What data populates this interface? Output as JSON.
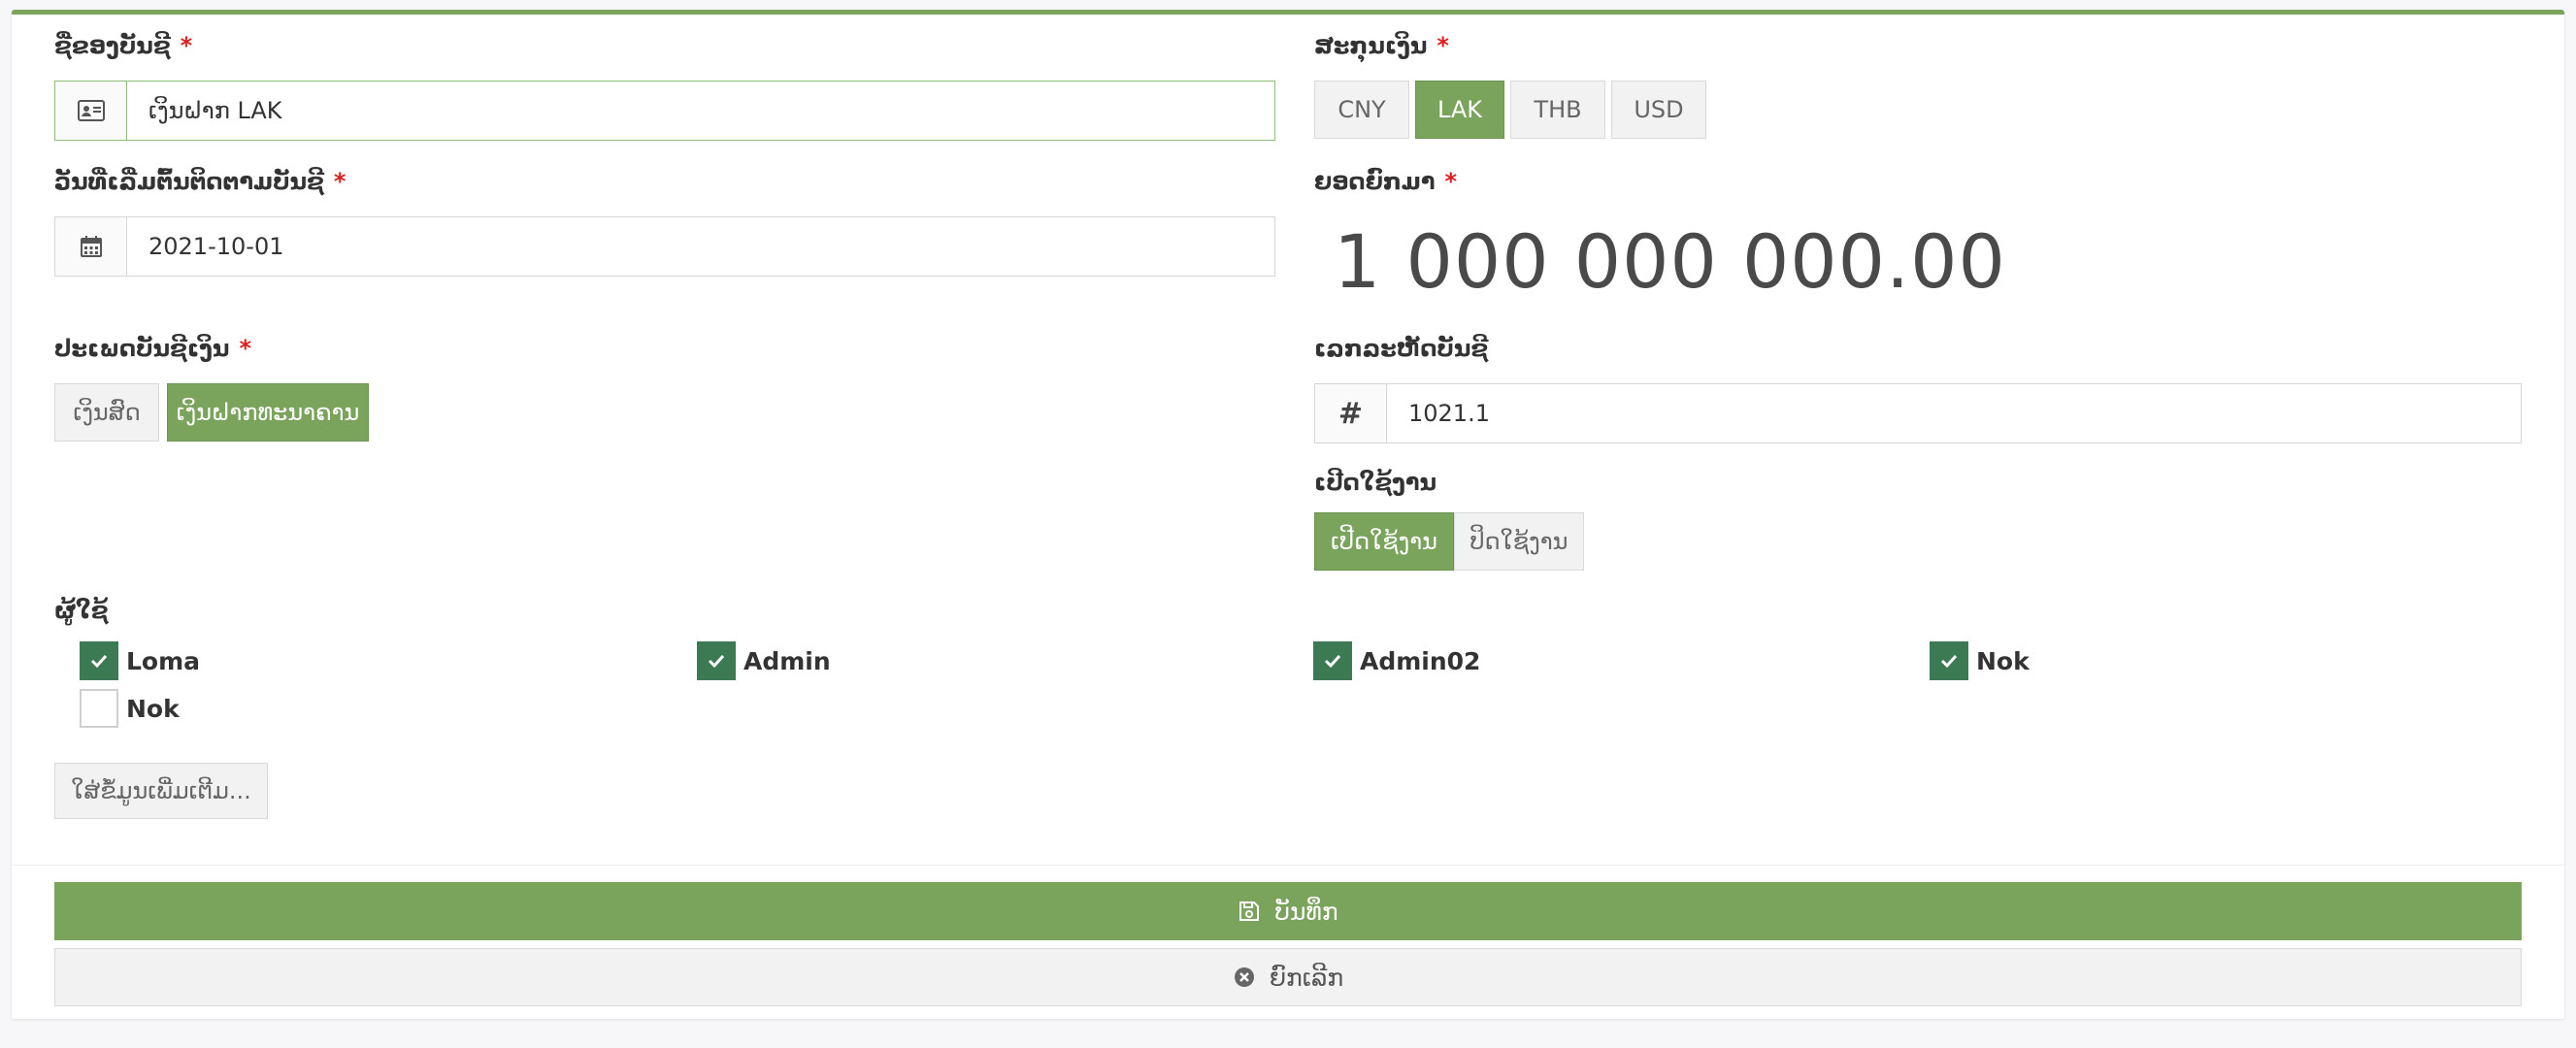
{
  "form": {
    "account_name": {
      "label": "ຊື່ຂອງບັນຊີ",
      "required_mark": "*",
      "value": "ເງິນຝາກ LAK",
      "icon": "id-card-icon"
    },
    "currency": {
      "label": "ສະກຸນເງິນ",
      "required_mark": "*",
      "options": [
        "CNY",
        "LAK",
        "THB",
        "USD"
      ],
      "selected": "LAK"
    },
    "start_date": {
      "label": "ວັນທີ່ເລີ່ມຕົ້ນຕິດຕາມບັນຊີ",
      "required_mark": "*",
      "value": "2021-10-01",
      "icon": "calendar-icon"
    },
    "balance": {
      "label": "ຍອດຍົກມາ",
      "required_mark": "*",
      "value": "1 000 000 000.00"
    },
    "account_type": {
      "label": "ປະເພດບັນຊີເງິນ",
      "required_mark": "*",
      "options": [
        "ເງິນສົດ",
        "ເງິນຝາກທະນາຄານ"
      ],
      "selected": "ເງິນຝາກທະນາຄານ"
    },
    "account_code": {
      "label": "ເລກລະຫັດບັນຊີ",
      "value": "1021.1",
      "addon_symbol": "#"
    },
    "status": {
      "label": "ເປີດໃຊ້ງານ",
      "options": [
        "ເປີດໃຊ້ງານ",
        "ປິດໃຊ້ງານ"
      ],
      "selected": "ເປີດໃຊ້ງານ"
    },
    "users": {
      "label": "ຜູ້ໃຊ້",
      "items": [
        {
          "name": "Loma",
          "checked": true
        },
        {
          "name": "Admin",
          "checked": true
        },
        {
          "name": "Admin02",
          "checked": true
        },
        {
          "name": "Nok",
          "checked": true
        },
        {
          "name": "Nok",
          "checked": false
        }
      ]
    },
    "more_info_button": "ໃສ່ຂໍ້ມູນເພີ່ມເຕີມ..."
  },
  "actions": {
    "save_label": "ບັນທຶກ",
    "cancel_label": "ຍົກເລີກ"
  },
  "colors": {
    "accent_green": "#7aa35b",
    "checkbox_green": "#3c7a54",
    "required_red": "#e02020"
  }
}
